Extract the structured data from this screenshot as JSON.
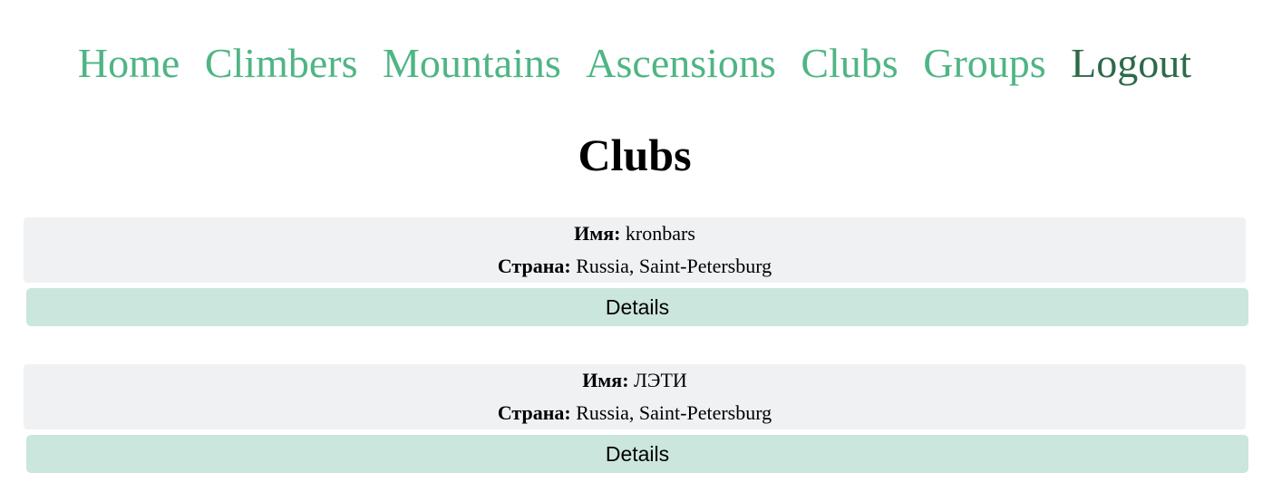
{
  "nav": {
    "home": "Home",
    "climbers": "Climbers",
    "mountains": "Mountains",
    "ascensions": "Ascensions",
    "clubs": "Clubs",
    "groups": "Groups",
    "logout": "Logout"
  },
  "page_title": "Clubs",
  "labels": {
    "name": "Имя:",
    "country": "Страна:"
  },
  "clubs": [
    {
      "name": "kronbars",
      "country": "Russia, Saint-Petersburg",
      "details_label": "Details"
    },
    {
      "name": "ЛЭТИ",
      "country": "Russia, Saint-Petersburg",
      "details_label": "Details"
    }
  ],
  "colors": {
    "nav_link": "#4fb584",
    "nav_logout": "#2e6a4a",
    "card_bg": "#f0f1f3",
    "button_bg": "#cbe6dc"
  }
}
